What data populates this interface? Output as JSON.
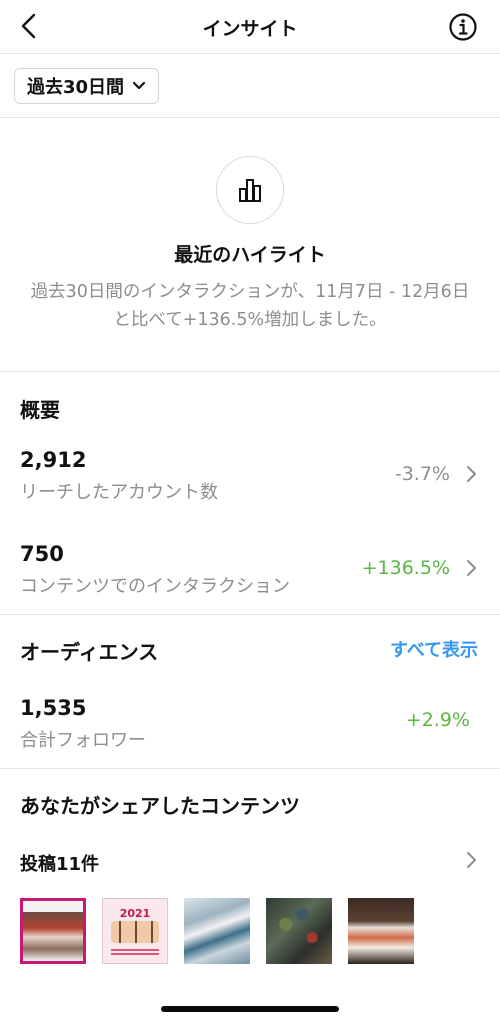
{
  "header": {
    "title": "インサイト",
    "back_icon": "chevron-left-icon",
    "info_icon": "info-icon"
  },
  "period": {
    "label": "過去30日間"
  },
  "highlight": {
    "title": "最近のハイライト",
    "description": "過去30日間のインタラクションが、11月7日 - 12月6日と比べて+136.5%増加しました。"
  },
  "overview": {
    "title": "概要",
    "rows": [
      {
        "value": "2,912",
        "label": "リーチしたアカウント数",
        "change": "-3.7%"
      },
      {
        "value": "750",
        "label": "コンテンツでのインタラクション",
        "change": "+136.5%"
      }
    ]
  },
  "audience": {
    "title": "オーディエンス",
    "see_all": "すべて表示",
    "value": "1,535",
    "label": "合計フォロワー",
    "change": "+2.9%"
  },
  "content": {
    "title": "あなたがシェアしたコンテンツ",
    "posts_label": "投稿11件",
    "thumb_2_year": "2021"
  },
  "colors": {
    "positive": "#5cb642",
    "negative_gray": "#8e8e8e",
    "link_blue": "#3897f0"
  }
}
